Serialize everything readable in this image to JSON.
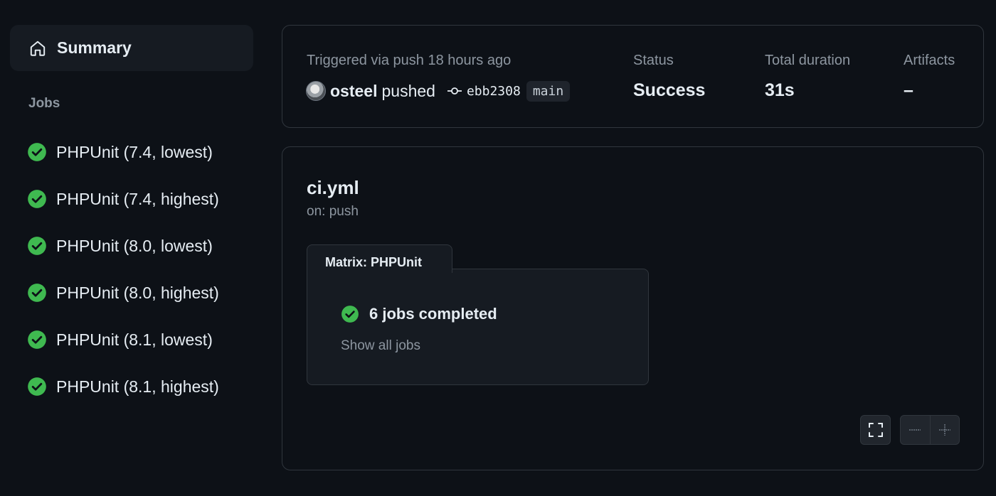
{
  "sidebar": {
    "summary_label": "Summary",
    "jobs_heading": "Jobs",
    "jobs": [
      {
        "label": "PHPUnit (7.4, lowest)",
        "status": "success"
      },
      {
        "label": "PHPUnit (7.4, highest)",
        "status": "success"
      },
      {
        "label": "PHPUnit (8.0, lowest)",
        "status": "success"
      },
      {
        "label": "PHPUnit (8.0, highest)",
        "status": "success"
      },
      {
        "label": "PHPUnit (8.1, lowest)",
        "status": "success"
      },
      {
        "label": "PHPUnit (8.1, highest)",
        "status": "success"
      }
    ]
  },
  "run": {
    "trigger_text": "Triggered via push 18 hours ago",
    "actor": "osteel",
    "action": "pushed",
    "commit_sha": "ebb2308",
    "branch": "main",
    "status_label": "Status",
    "status_value": "Success",
    "duration_label": "Total duration",
    "duration_value": "31s",
    "artifacts_label": "Artifacts",
    "artifacts_value": "–"
  },
  "workflow": {
    "file": "ci.yml",
    "trigger": "on: push",
    "matrix_title": "Matrix: PHPUnit",
    "matrix_status": "6 jobs completed",
    "show_all": "Show all jobs"
  },
  "icons": {
    "home": "home-icon",
    "check": "check-circle-fill-icon",
    "commit": "git-commit-icon",
    "fullscreen": "fullscreen-icon",
    "zoom_out": "zoom-out-icon",
    "zoom_in": "zoom-in-icon"
  },
  "colors": {
    "background": "#0d1117",
    "success": "#3fb950",
    "border": "#30363d",
    "muted_text": "#8d96a0"
  }
}
